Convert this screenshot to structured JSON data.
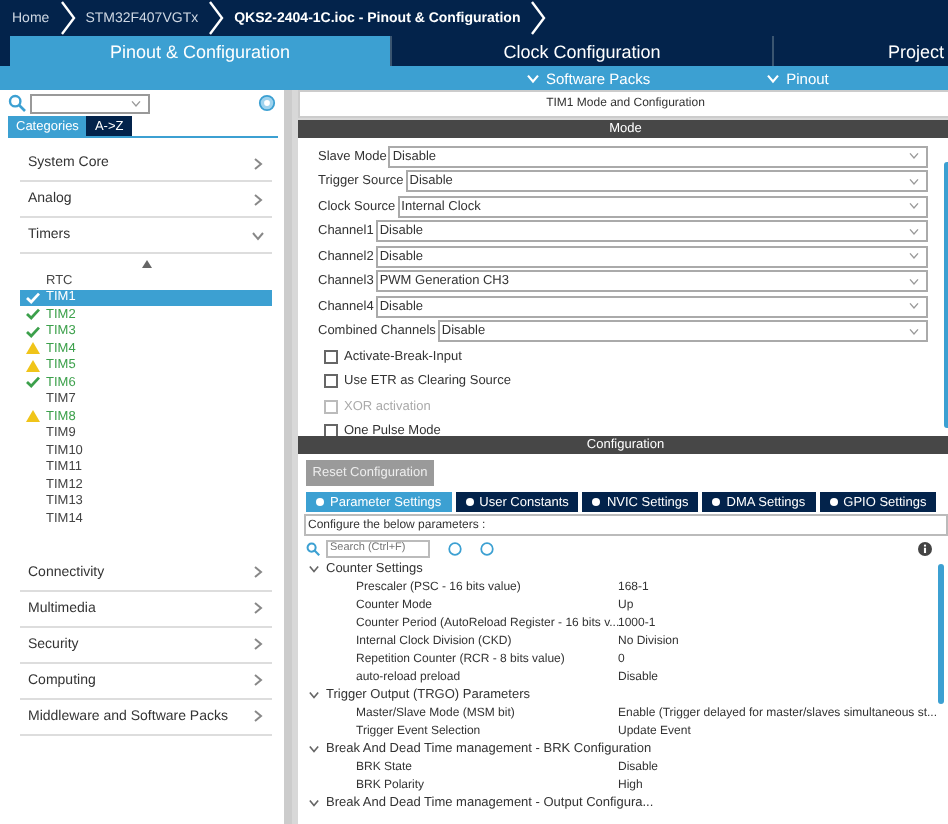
{
  "breadcrumbs": [
    "Home",
    "STM32F407VGTx",
    "QKS2-2404-1C.ioc - Pinout & Configuration"
  ],
  "tabs": [
    {
      "label": "Pinout & Configuration",
      "selected": true
    },
    {
      "label": "Clock Configuration",
      "selected": false
    },
    {
      "label": "Project",
      "selected": false
    }
  ],
  "sub_menus": [
    "Software Packs",
    "Pinout"
  ],
  "sidebar": {
    "view_tabs": [
      {
        "label": "Categories",
        "selected": true
      },
      {
        "label": "A->Z",
        "selected": false
      }
    ],
    "categories": [
      {
        "label": "System Core",
        "expanded": false
      },
      {
        "label": "Analog",
        "expanded": false
      },
      {
        "label": "Timers",
        "expanded": true,
        "children": [
          {
            "label": "RTC",
            "selected": false,
            "configured": false,
            "warning": false
          },
          {
            "label": "TIM1",
            "selected": true,
            "configured": true,
            "warning": false
          },
          {
            "label": "TIM2",
            "selected": false,
            "configured": true,
            "warning": false
          },
          {
            "label": "TIM3",
            "selected": false,
            "configured": true,
            "warning": false
          },
          {
            "label": "TIM4",
            "selected": false,
            "configured": true,
            "warning": true
          },
          {
            "label": "TIM5",
            "selected": false,
            "configured": true,
            "warning": true
          },
          {
            "label": "TIM6",
            "selected": false,
            "configured": true,
            "warning": false
          },
          {
            "label": "TIM7",
            "selected": false,
            "configured": false,
            "warning": false
          },
          {
            "label": "TIM8",
            "selected": false,
            "configured": true,
            "warning": true
          },
          {
            "label": "TIM9",
            "selected": false,
            "configured": false,
            "warning": false
          },
          {
            "label": "TIM10",
            "selected": false,
            "configured": false,
            "warning": false
          },
          {
            "label": "TIM11",
            "selected": false,
            "configured": false,
            "warning": false
          },
          {
            "label": "TIM12",
            "selected": false,
            "configured": false,
            "warning": false
          },
          {
            "label": "TIM13",
            "selected": false,
            "configured": false,
            "warning": false
          },
          {
            "label": "TIM14",
            "selected": false,
            "configured": false,
            "warning": false
          }
        ]
      },
      {
        "label": "Connectivity",
        "expanded": false
      },
      {
        "label": "Multimedia",
        "expanded": false
      },
      {
        "label": "Security",
        "expanded": false
      },
      {
        "label": "Computing",
        "expanded": false
      },
      {
        "label": "Middleware and Software Packs",
        "expanded": false
      }
    ]
  },
  "panel_title": "TIM1 Mode and Configuration",
  "mode": {
    "title": "Mode",
    "fields": [
      {
        "label": "Slave Mode",
        "value": "Disable"
      },
      {
        "label": "Trigger Source",
        "value": "Disable"
      },
      {
        "label": "Clock Source",
        "value": "Internal Clock"
      },
      {
        "label": "Channel1",
        "value": "Disable"
      },
      {
        "label": "Channel2",
        "value": "Disable"
      },
      {
        "label": "Channel3",
        "value": "PWM Generation CH3"
      },
      {
        "label": "Channel4",
        "value": "Disable"
      },
      {
        "label": "Combined Channels",
        "value": "Disable"
      }
    ],
    "checkboxes": [
      {
        "label": "Activate-Break-Input",
        "checked": false,
        "disabled": false
      },
      {
        "label": "Use ETR as Clearing Source",
        "checked": false,
        "disabled": false
      },
      {
        "label": "XOR activation",
        "checked": false,
        "disabled": true
      },
      {
        "label": "One Pulse Mode",
        "checked": false,
        "disabled": false
      }
    ]
  },
  "configuration": {
    "title": "Configuration",
    "reset_button": "Reset Configuration",
    "tabs": [
      {
        "label": "Parameter Settings",
        "selected": true
      },
      {
        "label": "User Constants",
        "selected": false
      },
      {
        "label": "NVIC Settings",
        "selected": false
      },
      {
        "label": "DMA Settings",
        "selected": false
      },
      {
        "label": "GPIO Settings",
        "selected": false
      }
    ],
    "hint": "Configure the below parameters :",
    "search": {
      "placeholder": "Search (Ctrl+F)"
    },
    "groups": [
      {
        "title": "Counter Settings",
        "expanded": true,
        "params": [
          {
            "name": "Prescaler (PSC - 16 bits value)",
            "value": "168-1"
          },
          {
            "name": "Counter Mode",
            "value": "Up"
          },
          {
            "name": "Counter Period (AutoReload Register - 16 bits v...",
            "value": "1000-1"
          },
          {
            "name": "Internal Clock Division (CKD)",
            "value": "No Division"
          },
          {
            "name": "Repetition Counter (RCR - 8 bits value)",
            "value": "0"
          },
          {
            "name": "auto-reload preload",
            "value": "Disable"
          }
        ]
      },
      {
        "title": "Trigger Output (TRGO) Parameters",
        "expanded": true,
        "params": [
          {
            "name": "Master/Slave Mode (MSM bit)",
            "value": "Enable (Trigger delayed for master/slaves simultaneous st..."
          },
          {
            "name": "Trigger Event Selection",
            "value": "Update Event"
          }
        ]
      },
      {
        "title": "Break And Dead Time management - BRK Configuration",
        "expanded": true,
        "params": [
          {
            "name": "BRK State",
            "value": "Disable"
          },
          {
            "name": "BRK Polarity",
            "value": "High"
          }
        ]
      },
      {
        "title": "Break And Dead Time management - Output Configura...",
        "expanded": true
      }
    ]
  }
}
